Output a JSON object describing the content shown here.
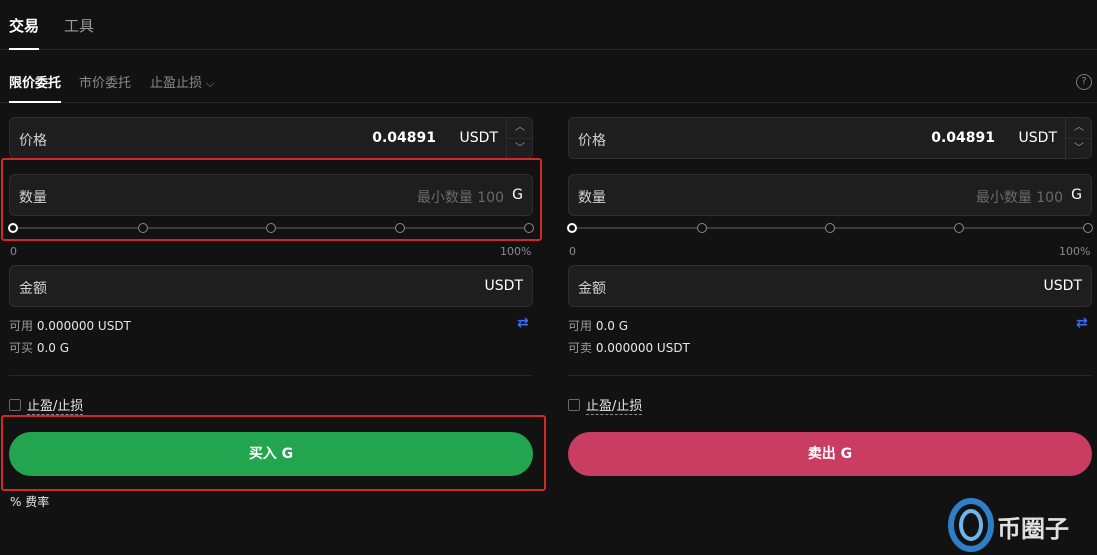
{
  "top_tabs": [
    {
      "label": "交易"
    },
    {
      "label": "工具"
    }
  ],
  "order_tabs": [
    {
      "label": "限价委托"
    },
    {
      "label": "市价委托"
    },
    {
      "label": "止盈止损"
    }
  ],
  "help_icon": {
    "glyph": "?"
  },
  "buy_panel": {
    "price": {
      "label": "价格",
      "value": "0.04891",
      "unit": "USDT"
    },
    "quantity": {
      "label": "数量",
      "placeholder": "最小数量 100",
      "unit": "G"
    },
    "slider": {
      "min_label": "0",
      "max_label": "100%",
      "value": 0
    },
    "amount": {
      "label": "金额",
      "unit": "USDT"
    },
    "available": {
      "label": "可用",
      "value": "0.000000 USDT"
    },
    "can_trade": {
      "label": "可买",
      "value": "0.0 G"
    },
    "tp_sl_label": "止盈/止损",
    "action_label": "买入 G",
    "action_color": "#23a550"
  },
  "sell_panel": {
    "price": {
      "label": "价格",
      "value": "0.04891",
      "unit": "USDT"
    },
    "quantity": {
      "label": "数量",
      "placeholder": "最小数量 100",
      "unit": "G"
    },
    "slider": {
      "min_label": "0",
      "max_label": "100%",
      "value": 0
    },
    "amount": {
      "label": "金额",
      "unit": "USDT"
    },
    "available": {
      "label": "可用",
      "value": "0.0 G"
    },
    "can_trade": {
      "label": "可卖",
      "value": "0.000000 USDT"
    },
    "tp_sl_label": "止盈/止损",
    "action_label": "卖出 G",
    "action_color": "#c93d62"
  },
  "fee": {
    "icon": "%",
    "label": "费率"
  },
  "stepper": {
    "up": "︿",
    "down": "﹀"
  },
  "transfer_icon": "⇄",
  "highlight_color": "#d12a22",
  "watermark": {
    "text": "币圈子"
  }
}
